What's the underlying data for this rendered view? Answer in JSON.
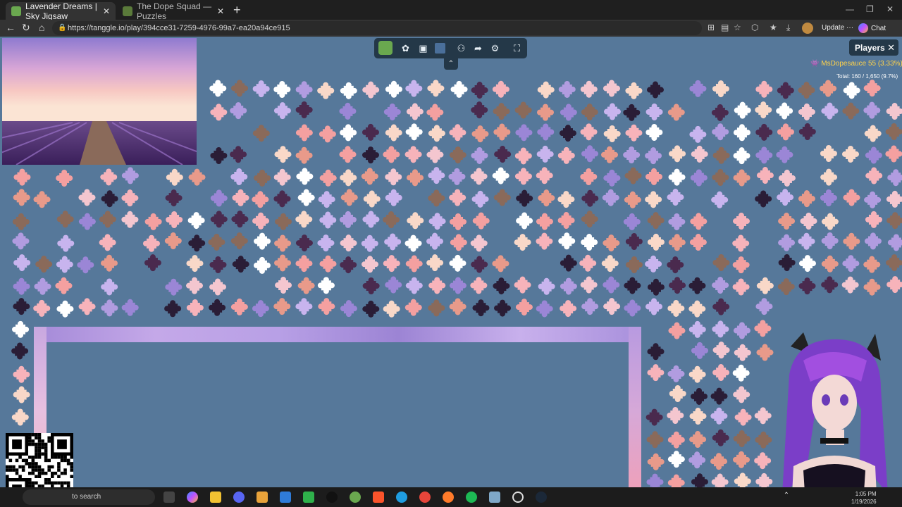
{
  "browser": {
    "tabs": [
      {
        "label": "Lavender Dreams | Sky Jigsaw",
        "active": true
      },
      {
        "label": "The Dope Squad — Puzzles",
        "active": false
      }
    ],
    "url": "https://tanggle.io/play/394cce31-7259-4976-99a7-ea20a94ce915",
    "update_label": "Update",
    "chat_label": "Chat"
  },
  "players_panel": {
    "title": "Players",
    "player_name": "MsDopesauce",
    "player_score": "55 (3.33%)",
    "total": "Total: 160 / 1,650 (9.7%)"
  },
  "toolbar": {
    "icons": [
      "puzzle-icon",
      "ghost-icon",
      "image-preview-icon",
      "background-color-icon",
      "players-icon",
      "share-icon",
      "settings-icon",
      "fullscreen-icon"
    ]
  },
  "taskbar": {
    "search_placeholder": "to search",
    "time": "1:05 PM",
    "date": "1/19/2026"
  },
  "colors": {
    "table": "#56789a",
    "toolbar": "#243848",
    "player_highlight": "#ffd24a"
  }
}
